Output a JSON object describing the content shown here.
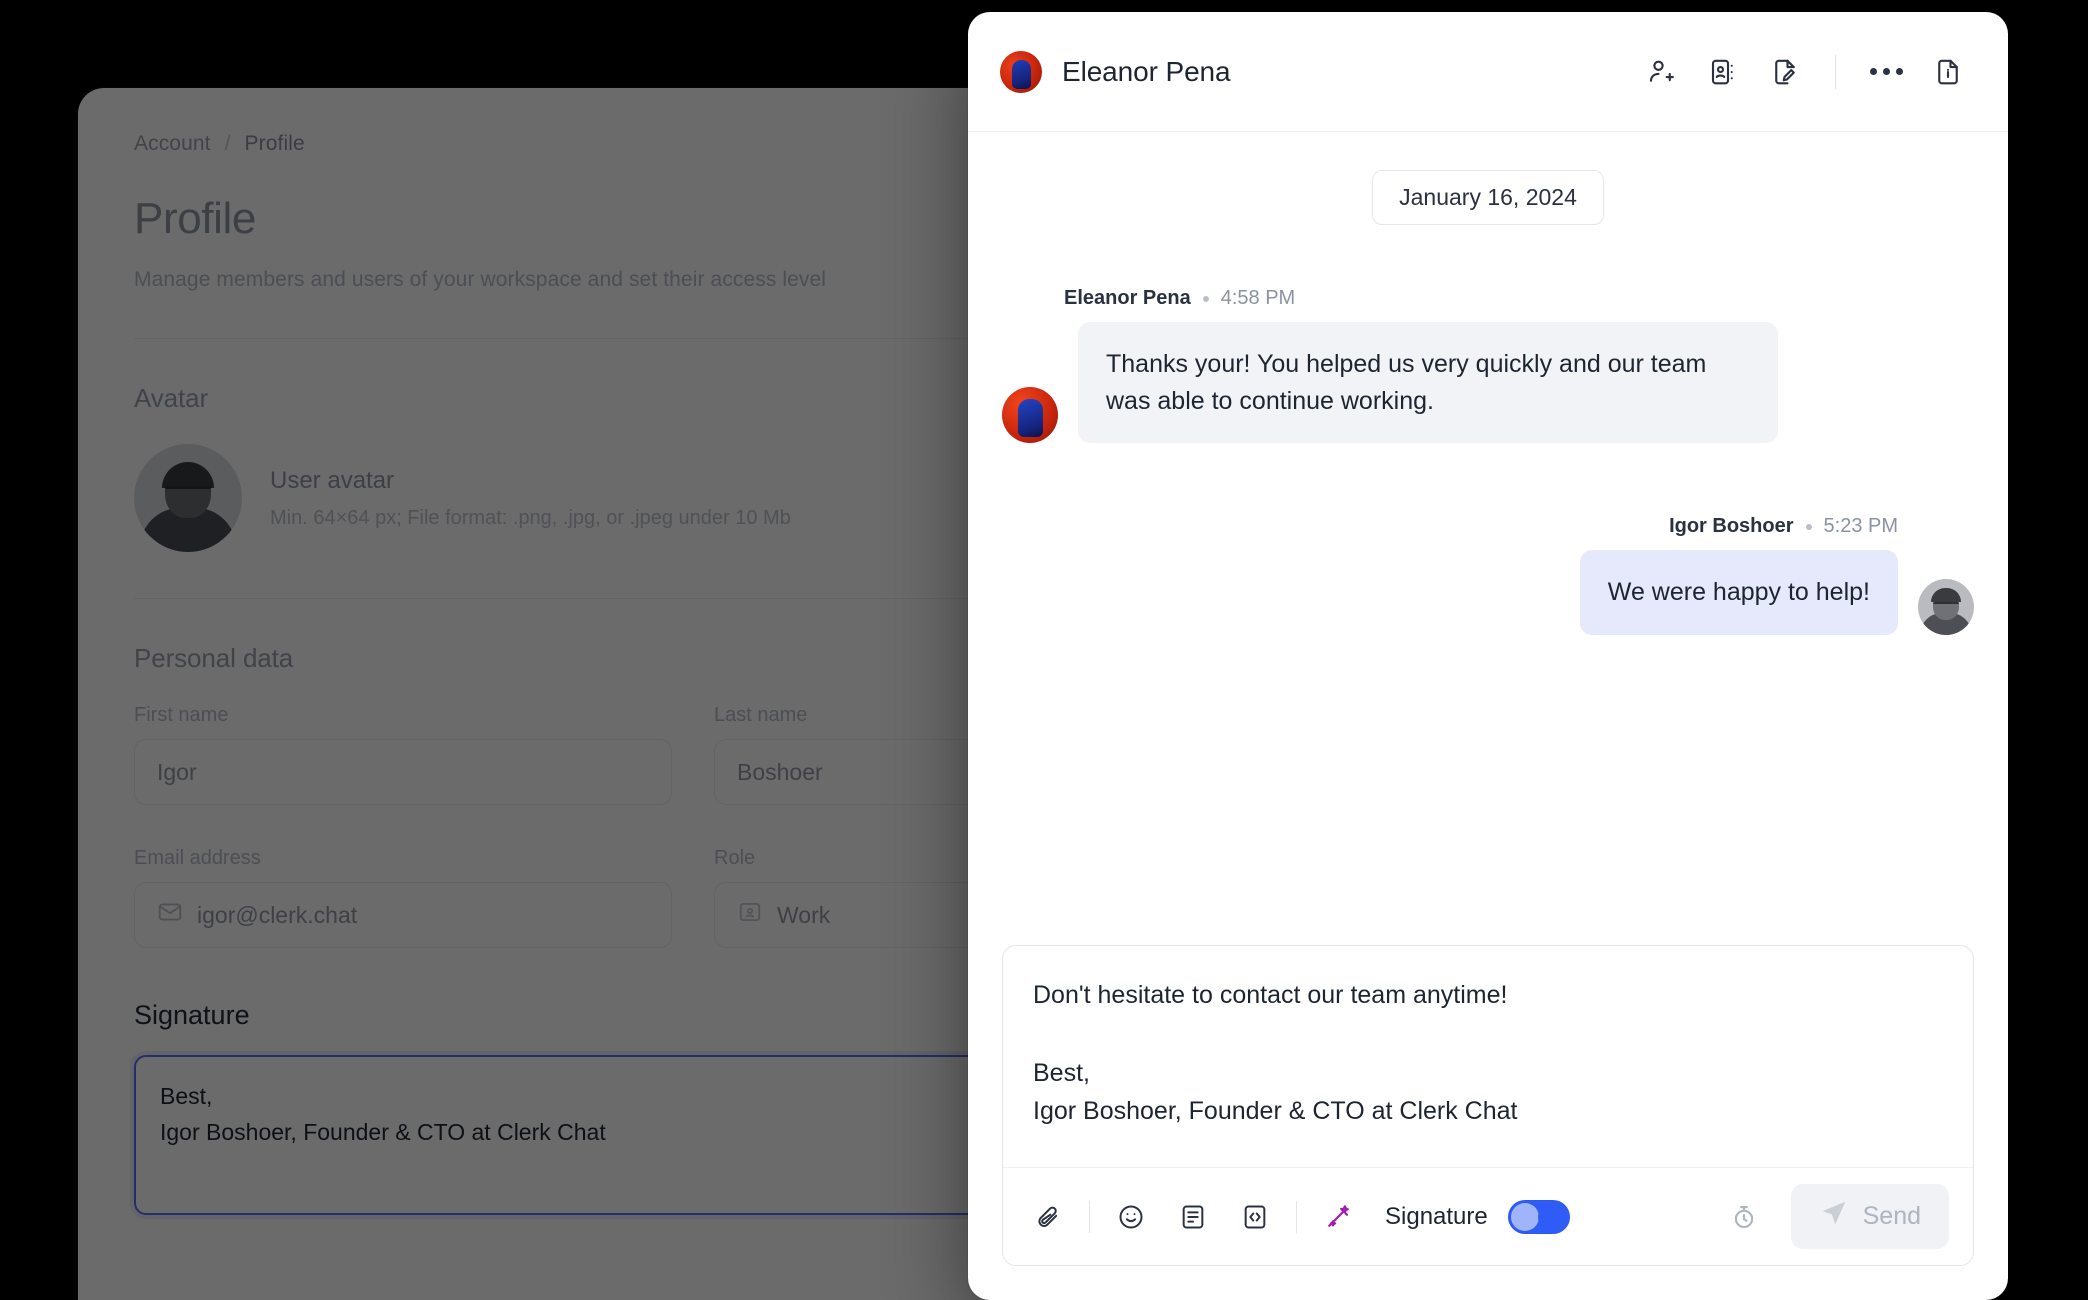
{
  "settings": {
    "breadcrumb": {
      "parent": "Account",
      "separator": "/",
      "current": "Profile"
    },
    "title": "Profile",
    "subtitle": "Manage members and users of your workspace and set their access level",
    "avatar_section": {
      "heading": "Avatar",
      "name": "User avatar",
      "hint": "Min. 64×64 px; File format: .png, .jpg, or .jpeg under 10 Mb"
    },
    "personal_section": {
      "heading": "Personal data",
      "fields": [
        {
          "label": "First name",
          "value": "Igor",
          "icon": ""
        },
        {
          "label": "Last name",
          "value": "Boshoer",
          "icon": ""
        },
        {
          "label": "Email address",
          "value": "igor@clerk.chat",
          "icon": "mail-icon"
        },
        {
          "label": "Role",
          "value": "Work",
          "icon": "contact-card-icon"
        }
      ]
    },
    "signature_section": {
      "heading": "Signature",
      "value": "Best,\nIgor Boshoer, Founder & CTO at Clerk Chat"
    }
  },
  "chat": {
    "header": {
      "peer_name": "Eleanor Pena",
      "actions": [
        {
          "name": "add-contact-icon",
          "label": "Add contact"
        },
        {
          "name": "contact-card-icon",
          "label": "Contact details"
        },
        {
          "name": "note-edit-icon",
          "label": "Edit note"
        },
        {
          "name": "more-options-icon",
          "label": "More"
        },
        {
          "name": "file-info-icon",
          "label": "File info"
        }
      ]
    },
    "date_divider": "January 16, 2024",
    "messages": [
      {
        "sender": "Eleanor Pena",
        "time": "4:58 PM",
        "direction": "incoming",
        "text": "Thanks your! You helped us very quickly and our team was able to continue working."
      },
      {
        "sender": "Igor Boshoer",
        "time": "5:23 PM",
        "direction": "outgoing",
        "text": "We were happy to help!"
      }
    ],
    "composer": {
      "value": "Don't hesitate to contact our team anytime!\n\nBest,\nIgor Boshoer, Founder & CTO at Clerk Chat",
      "tools": [
        {
          "name": "attachment-icon",
          "label": "Attach file"
        },
        {
          "name": "emoji-icon",
          "label": "Emoji"
        },
        {
          "name": "template-icon",
          "label": "Templates"
        },
        {
          "name": "code-icon",
          "label": "Variables"
        },
        {
          "name": "magic-wand-icon",
          "label": "AI assist"
        }
      ],
      "signature_label": "Signature",
      "signature_enabled": true,
      "schedule_icon": "schedule-send-icon",
      "send_label": "Send",
      "send_enabled": false
    }
  },
  "colors": {
    "accent_blue": "#2f5cf6",
    "focus_border": "#5b6ef5",
    "magic_purple": "#a21caf",
    "outgoing_bubble": "#e6e9fb",
    "incoming_bubble": "#f1f3f7"
  }
}
